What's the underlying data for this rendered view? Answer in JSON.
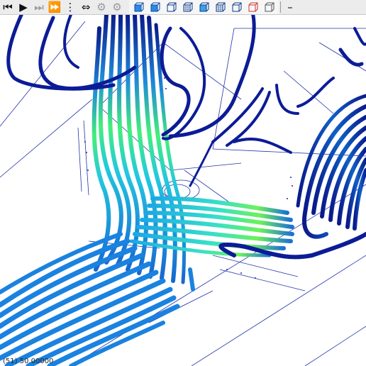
{
  "status": {
    "frame_text": "(51) 50.00000"
  },
  "toolbar": {
    "playback": [
      {
        "name": "step-back-icon",
        "glyph": "⏮"
      },
      {
        "name": "play-icon",
        "glyph": "▶"
      },
      {
        "name": "step-forward-icon",
        "glyph": "⏭"
      },
      {
        "name": "fast-forward-icon",
        "glyph": "⏩"
      },
      {
        "name": "more-options-icon",
        "glyph": "⋮"
      },
      {
        "name": "loop-icon",
        "glyph": "⇔"
      },
      {
        "name": "walk-icon",
        "glyph": "⚙"
      },
      {
        "name": "run-icon",
        "glyph": "⚙"
      }
    ],
    "view_buttons": [
      "solid-cube-icon",
      "shaded-cube-icon",
      "outline-cube-icon",
      "grid-cube-icon",
      "blue-cube-icon",
      "mesh-cube-icon",
      "wire-cube-icon",
      "red-cube-icon",
      "white-cube-icon"
    ]
  },
  "colors": {
    "dark": "#0a1a8a",
    "mid": "#1d6fd6",
    "cyan": "#2fc6e6",
    "green": "#3cf06e"
  }
}
